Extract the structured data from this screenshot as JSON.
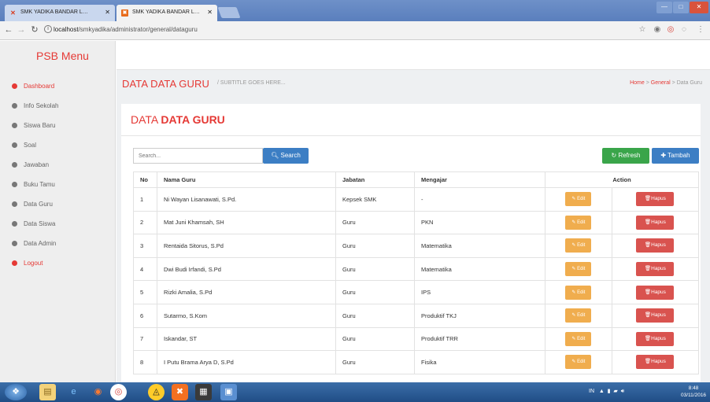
{
  "browser": {
    "tabs": [
      {
        "label": "SMK YADIKA BANDAR L…",
        "active": false
      },
      {
        "label": "SMK YADIKA BANDAR L…",
        "active": true
      }
    ],
    "url_host": "localhost",
    "url_path": "/smkyadika/administrator/general/dataguru"
  },
  "sidebar": {
    "brand": "PSB Menu",
    "items": [
      {
        "label": "Dashboard",
        "highlight": true
      },
      {
        "label": "Info Sekolah",
        "highlight": false
      },
      {
        "label": "Siswa Baru",
        "highlight": false
      },
      {
        "label": "Soal",
        "highlight": false
      },
      {
        "label": "Jawaban",
        "highlight": false
      },
      {
        "label": "Buku Tamu",
        "highlight": false
      },
      {
        "label": "Data Guru",
        "highlight": false
      },
      {
        "label": "Data Siswa",
        "highlight": false
      },
      {
        "label": "Data Admin",
        "highlight": false
      },
      {
        "label": "Logout",
        "highlight": true
      }
    ]
  },
  "page": {
    "title": "DATA DATA GURU",
    "subtitle": "/ SUBTITLE GOES HERE...",
    "breadcrumb": [
      "Home",
      "General",
      "Data Guru"
    ],
    "breadcrumb_sep": ">"
  },
  "panel": {
    "title_light": "DATA",
    "title_bold": "DATA GURU",
    "search_placeholder": "Search...",
    "search_button": "Search",
    "refresh_button": "Refresh",
    "add_button": "Tambah"
  },
  "table": {
    "headers": [
      "No",
      "Nama Guru",
      "Jabatan",
      "Mengajar",
      "Action"
    ],
    "edit_label": "Edit",
    "delete_label": "Hapus",
    "rows": [
      {
        "no": "1",
        "nama": "Ni Wayan Lisanawati, S.Pd.",
        "jabatan": "Kepsek SMK",
        "mengajar": "-"
      },
      {
        "no": "2",
        "nama": "Mat Juni Khamsah, SH",
        "jabatan": "Guru",
        "mengajar": "PKN"
      },
      {
        "no": "3",
        "nama": "Rentaida Sitorus, S.Pd",
        "jabatan": "Guru",
        "mengajar": "Matematika"
      },
      {
        "no": "4",
        "nama": "Dwi Budi Irfandi, S.Pd",
        "jabatan": "Guru",
        "mengajar": "Matematika"
      },
      {
        "no": "5",
        "nama": "Rizki Amalia, S.Pd",
        "jabatan": "Guru",
        "mengajar": "IPS"
      },
      {
        "no": "6",
        "nama": "Sutarmo, S.Kom",
        "jabatan": "Guru",
        "mengajar": "Produktif TKJ"
      },
      {
        "no": "7",
        "nama": "Iskandar, ST",
        "jabatan": "Guru",
        "mengajar": "Produktif TRR"
      },
      {
        "no": "8",
        "nama": "I Putu Brama Arya D, S.Pd",
        "jabatan": "Guru",
        "mengajar": "Fisika"
      }
    ]
  },
  "taskbar": {
    "tray_lang": "IN",
    "time": "8:48",
    "date": "03/11/2016"
  }
}
